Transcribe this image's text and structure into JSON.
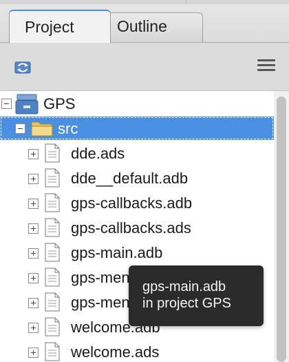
{
  "tabs": [
    {
      "label": "Project",
      "active": true
    },
    {
      "label": "Outline",
      "active": false
    }
  ],
  "toolbar": {
    "sync_icon": "sync-icon",
    "menu_icon": "hamburger-menu-icon"
  },
  "tree": {
    "project": {
      "label": "GPS",
      "icon": "database-project-icon",
      "expanded": true
    },
    "folder": {
      "label": "src",
      "icon": "folder-icon",
      "expanded": true,
      "selected": true
    },
    "files": [
      {
        "label": "dde.ads"
      },
      {
        "label": "dde__default.adb"
      },
      {
        "label": "gps-callbacks.adb"
      },
      {
        "label": "gps-callbacks.ads"
      },
      {
        "label": "gps-main.adb"
      },
      {
        "label": "gps-men"
      },
      {
        "label": "gps-men"
      },
      {
        "label": "welcome.adb"
      },
      {
        "label": "welcome.ads"
      }
    ]
  },
  "tooltip": {
    "line1": "gps-main.adb",
    "line2": "in project GPS"
  },
  "colors": {
    "selection": "#4a90e2",
    "tab_accent": "#4f8fcf",
    "tooltip_bg": "#2b2b2b"
  }
}
